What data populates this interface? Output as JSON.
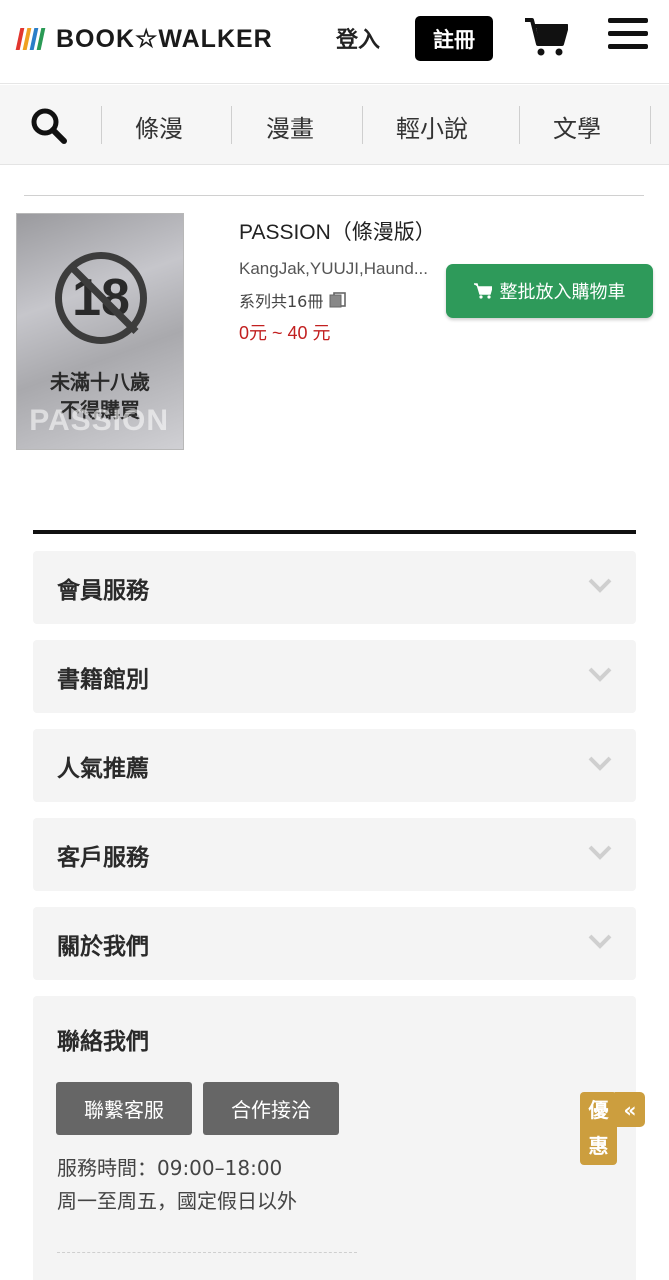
{
  "header": {
    "logo_text": "BOOK☆WALKER",
    "logo_bar_colors": [
      "#e2362f",
      "#f0a020",
      "#2a7ec8",
      "#2a9a55"
    ],
    "login_label": "登入",
    "register_label": "註冊",
    "cart_icon": "shopping-cart-icon",
    "menu_icon": "hamburger-menu-icon"
  },
  "nav": {
    "search_icon": "search-icon",
    "items": [
      {
        "label": "條漫"
      },
      {
        "label": "漫畫"
      },
      {
        "label": "輕小說"
      },
      {
        "label": "文學"
      }
    ]
  },
  "book": {
    "cover": {
      "age_number": "18",
      "warning_line1": "未滿十八歲",
      "warning_line2": "不得購買",
      "cover_title": "PASSION"
    },
    "title": "PASSION（條漫版）",
    "authors": "KangJak,YUUJI,Haund...",
    "series_count": "系列共16冊",
    "price": "0元 ~ 40 元",
    "bulk_cart_label": "整批放入購物車",
    "accent_color": "#2e9a5a",
    "price_color": "#c22020"
  },
  "footer": {
    "sections": [
      {
        "label": "會員服務"
      },
      {
        "label": "書籍館別"
      },
      {
        "label": "人氣推薦"
      },
      {
        "label": "客戶服務"
      },
      {
        "label": "關於我們"
      }
    ],
    "contact": {
      "title": "聯絡我們",
      "buttons": [
        "聯繫客服",
        "合作接洽"
      ],
      "hours": "服務時間：09:00–18:00",
      "days": "周一至周五，國定假日以外"
    }
  },
  "promo": {
    "line1": "優",
    "line2": "惠",
    "arrow": "«",
    "color": "#cc9e3e"
  }
}
